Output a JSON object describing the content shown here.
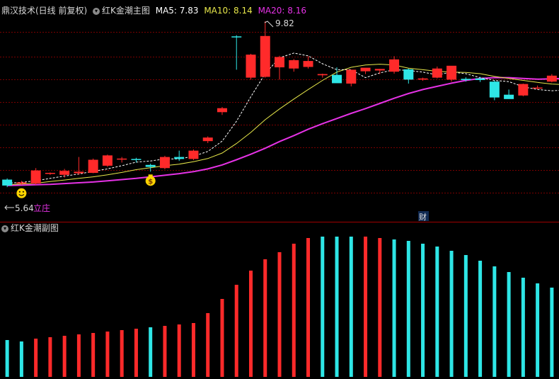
{
  "colors": {
    "up": "#ff2a2a",
    "down": "#2ee6e6",
    "ma5": "#ffffff",
    "ma10": "#e8e84a",
    "ma20": "#e632e6",
    "grid": "#7a0000",
    "text": "#d8d8d8",
    "annotation": "#ffd400"
  },
  "main_panel": {
    "stock_name": "鼎汉技术(日线 前复权)",
    "indicator_name": "红K金潮主图",
    "ma5_label": "MA5: 7.83",
    "ma10_label": "MA10: 8.14",
    "ma20_label": "MA20: 8.16",
    "high_label": "9.82",
    "low_label": "5.64",
    "signal_text": "立庄",
    "event_marker": "财"
  },
  "sub_panel": {
    "indicator_name": "红K金潮副图"
  },
  "chart_data": [
    {
      "type": "candlestick",
      "title": "红K金潮主图",
      "ylim": [
        5.0,
        10.0
      ],
      "max_price": 9.82,
      "min_price": 5.64,
      "candles": [
        {
          "o": 5.83,
          "h": 5.86,
          "l": 5.64,
          "c": 5.68
        },
        {
          "o": 5.73,
          "h": 5.8,
          "l": 5.7,
          "c": 5.76
        },
        {
          "o": 5.73,
          "h": 6.12,
          "l": 5.7,
          "c": 6.06
        },
        {
          "o": 5.98,
          "h": 6.01,
          "l": 5.95,
          "c": 6.0
        },
        {
          "o": 5.95,
          "h": 6.1,
          "l": 5.88,
          "c": 6.05
        },
        {
          "o": 5.99,
          "h": 6.4,
          "l": 5.95,
          "c": 6.03
        },
        {
          "o": 6.0,
          "h": 6.36,
          "l": 5.99,
          "c": 6.33
        },
        {
          "o": 6.18,
          "h": 6.46,
          "l": 6.15,
          "c": 6.44
        },
        {
          "o": 6.35,
          "h": 6.4,
          "l": 6.26,
          "c": 6.36
        },
        {
          "o": 6.35,
          "h": 6.38,
          "l": 6.26,
          "c": 6.33
        },
        {
          "o": 6.2,
          "h": 6.23,
          "l": 6.03,
          "c": 6.15
        },
        {
          "o": 6.12,
          "h": 6.43,
          "l": 6.09,
          "c": 6.4
        },
        {
          "o": 6.4,
          "h": 6.56,
          "l": 6.3,
          "c": 6.35
        },
        {
          "o": 6.35,
          "h": 6.59,
          "l": 6.32,
          "c": 6.56
        },
        {
          "o": 6.8,
          "h": 6.92,
          "l": 6.75,
          "c": 6.89
        },
        {
          "o": 7.53,
          "h": 7.66,
          "l": 7.46,
          "c": 7.63
        },
        {
          "o": 9.44,
          "h": 9.47,
          "l": 8.6,
          "c": 9.43
        },
        {
          "o": 8.4,
          "h": 9.0,
          "l": 8.35,
          "c": 8.98
        },
        {
          "o": 8.42,
          "h": 9.82,
          "l": 8.4,
          "c": 9.45
        },
        {
          "o": 8.66,
          "h": 8.95,
          "l": 8.35,
          "c": 8.92
        },
        {
          "o": 8.63,
          "h": 8.87,
          "l": 8.55,
          "c": 8.84
        },
        {
          "o": 8.67,
          "h": 8.94,
          "l": 8.63,
          "c": 8.82
        },
        {
          "o": 8.46,
          "h": 8.5,
          "l": 8.4,
          "c": 8.49
        },
        {
          "o": 8.47,
          "h": 8.66,
          "l": 8.37,
          "c": 8.26
        },
        {
          "o": 8.25,
          "h": 8.6,
          "l": 8.18,
          "c": 8.6
        },
        {
          "o": 8.56,
          "h": 8.61,
          "l": 8.49,
          "c": 8.65
        },
        {
          "o": 8.58,
          "h": 8.62,
          "l": 8.49,
          "c": 8.62
        },
        {
          "o": 8.55,
          "h": 8.94,
          "l": 8.5,
          "c": 8.86
        },
        {
          "o": 8.61,
          "h": 8.63,
          "l": 8.25,
          "c": 8.35
        },
        {
          "o": 8.35,
          "h": 8.4,
          "l": 8.32,
          "c": 8.38
        },
        {
          "o": 8.4,
          "h": 8.68,
          "l": 8.38,
          "c": 8.63
        },
        {
          "o": 8.35,
          "h": 8.68,
          "l": 8.3,
          "c": 8.7
        },
        {
          "o": 8.37,
          "h": 8.41,
          "l": 8.3,
          "c": 8.34
        },
        {
          "o": 8.38,
          "h": 8.42,
          "l": 8.29,
          "c": 8.34
        },
        {
          "o": 8.3,
          "h": 8.33,
          "l": 7.83,
          "c": 7.9
        },
        {
          "o": 7.97,
          "h": 8.1,
          "l": 7.87,
          "c": 7.86
        },
        {
          "o": 7.95,
          "h": 8.25,
          "l": 7.93,
          "c": 8.24
        },
        {
          "o": 8.13,
          "h": 8.2,
          "l": 8.1,
          "c": 8.15
        },
        {
          "o": 8.3,
          "h": 8.49,
          "l": 8.28,
          "c": 8.45
        }
      ],
      "ma5": [
        5.74,
        5.76,
        5.8,
        5.86,
        5.92,
        5.97,
        6.04,
        6.1,
        6.18,
        6.27,
        6.3,
        6.35,
        6.35,
        6.42,
        6.54,
        6.8,
        7.3,
        7.92,
        8.5,
        8.9,
        9.02,
        8.95,
        8.75,
        8.6,
        8.6,
        8.4,
        8.52,
        8.6,
        8.58,
        8.54,
        8.47,
        8.54,
        8.5,
        8.4,
        8.33,
        8.3,
        8.17,
        8.1,
        8.07,
        8.09
      ],
      "ma10": [
        5.7,
        5.72,
        5.74,
        5.78,
        5.82,
        5.86,
        5.9,
        5.95,
        6.01,
        6.08,
        6.13,
        6.18,
        6.22,
        6.28,
        6.36,
        6.5,
        6.74,
        7.02,
        7.34,
        7.61,
        7.86,
        8.1,
        8.33,
        8.54,
        8.66,
        8.72,
        8.74,
        8.72,
        8.64,
        8.6,
        8.56,
        8.54,
        8.53,
        8.5,
        8.43,
        8.38,
        8.33,
        8.28,
        8.24,
        8.22
      ],
      "ma20": [
        5.68,
        5.69,
        5.7,
        5.71,
        5.73,
        5.75,
        5.77,
        5.8,
        5.83,
        5.86,
        5.9,
        5.94,
        5.98,
        6.03,
        6.1,
        6.2,
        6.33,
        6.47,
        6.62,
        6.79,
        6.94,
        7.1,
        7.24,
        7.37,
        7.5,
        7.62,
        7.75,
        7.88,
        8.0,
        8.1,
        8.18,
        8.26,
        8.33,
        8.38,
        8.4,
        8.4,
        8.38,
        8.36,
        8.37,
        8.38
      ],
      "signals": [
        {
          "index": 1,
          "kind": "smiley-icon"
        },
        {
          "index": 10,
          "kind": "money-bag-icon"
        }
      ]
    },
    {
      "type": "bar",
      "title": "红K金潮副图",
      "ylim": [
        0,
        100
      ],
      "values": [
        26,
        25,
        27,
        28,
        29,
        30,
        31,
        32,
        33,
        34,
        35,
        36,
        37,
        38,
        45,
        55,
        65,
        75,
        83,
        88,
        94,
        98,
        99,
        99,
        99,
        99,
        98,
        97,
        96,
        94,
        92,
        89,
        86,
        82,
        78,
        74,
        70,
        66,
        63,
        61
      ],
      "colors": [
        "down",
        "down",
        "up",
        "up",
        "up",
        "up",
        "up",
        "up",
        "up",
        "up",
        "down",
        "up",
        "up",
        "up",
        "up",
        "up",
        "up",
        "up",
        "up",
        "up",
        "up",
        "up",
        "down",
        "down",
        "down",
        "up",
        "up",
        "down",
        "down",
        "down",
        "down",
        "down",
        "down",
        "down",
        "down",
        "down",
        "down",
        "down",
        "down",
        "down"
      ]
    }
  ]
}
